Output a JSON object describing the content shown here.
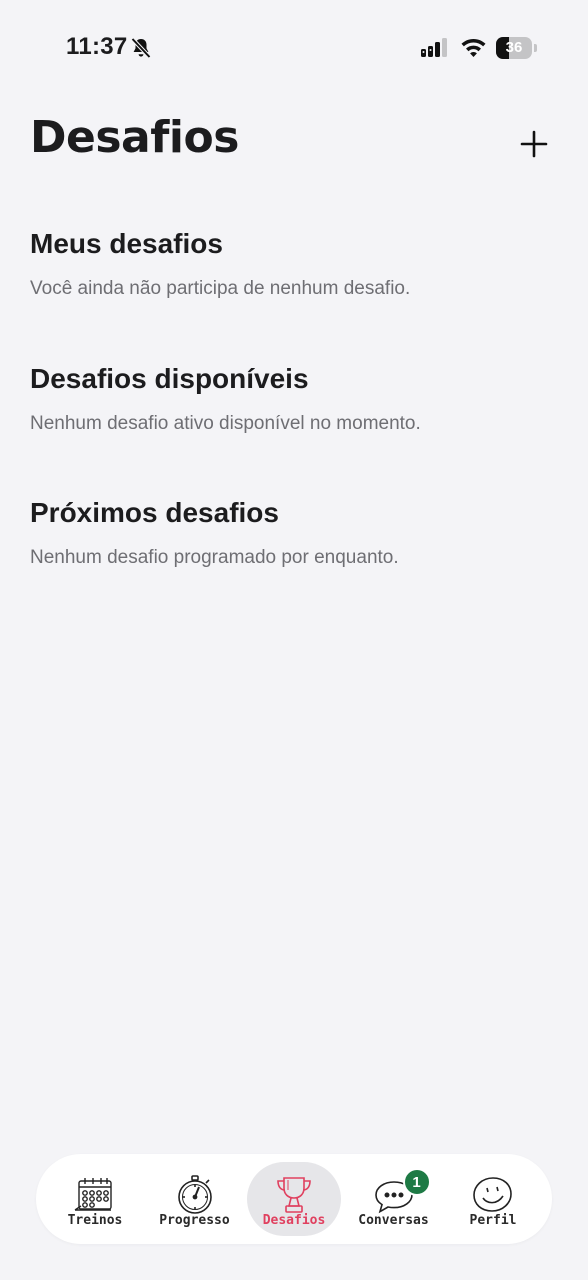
{
  "status_bar": {
    "time": "11:37",
    "battery_level": "36",
    "battery_fraction": 0.36,
    "icons": [
      "bell-off-icon",
      "signal-icon",
      "wifi-icon",
      "battery-icon"
    ]
  },
  "header": {
    "title": "Desafios",
    "add_icon": "plus-icon"
  },
  "sections": [
    {
      "title": "Meus desafios",
      "empty_text": "Você ainda não participa de nenhum desafio."
    },
    {
      "title": "Desafios disponíveis",
      "empty_text": "Nenhum desafio ativo disponível no momento."
    },
    {
      "title": "Próximos desafios",
      "empty_text": "Nenhum desafio programado por enquanto."
    }
  ],
  "tab_bar": {
    "active_color": "#e0405f",
    "badge_color": "#1e7a45",
    "tabs": [
      {
        "label": "Treinos",
        "icon": "calendar-icon",
        "active": false
      },
      {
        "label": "Progresso",
        "icon": "stopwatch-icon",
        "active": false
      },
      {
        "label": "Desafios",
        "icon": "trophy-icon",
        "active": true
      },
      {
        "label": "Conversas",
        "icon": "chat-bubble-icon",
        "active": false,
        "badge": "1"
      },
      {
        "label": "Perfil",
        "icon": "smiley-face-icon",
        "active": false
      }
    ]
  }
}
